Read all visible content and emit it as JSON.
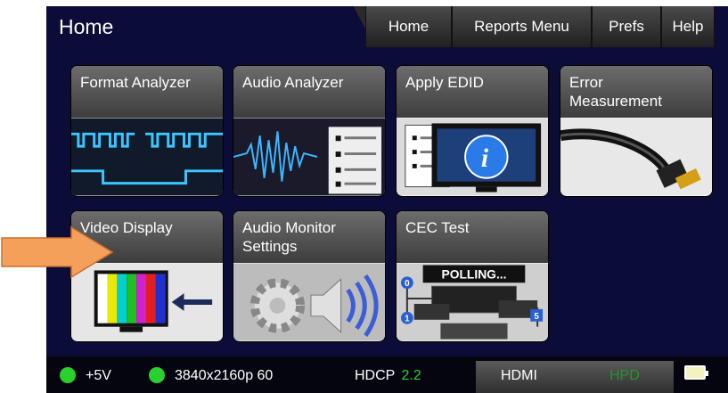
{
  "header": {
    "title": "Home"
  },
  "tabs": [
    "Home",
    "Reports Menu",
    "Prefs",
    "Help"
  ],
  "tiles": [
    {
      "label": "Format Analyzer"
    },
    {
      "label": "Audio Analyzer"
    },
    {
      "label": "Apply EDID"
    },
    {
      "label": "Error\nMeasurement"
    },
    {
      "label": "Video Display"
    },
    {
      "label": "Audio Monitor\nSettings"
    },
    {
      "label": "CEC Test",
      "polling_text": "POLLING...",
      "node_numbers": [
        "0",
        "1",
        "5"
      ]
    }
  ],
  "status": {
    "power": "+5V",
    "resolution": "3840x2160p 60",
    "hdcp_label": "HDCP",
    "hdcp_version": "2.2",
    "interface": "HDMI",
    "hpd": "HPD"
  },
  "colors": {
    "status_green": "#29d12f",
    "hpd_green": "#1f9a1f",
    "arrow": "#f5a05a",
    "background": "#0c0c38"
  }
}
